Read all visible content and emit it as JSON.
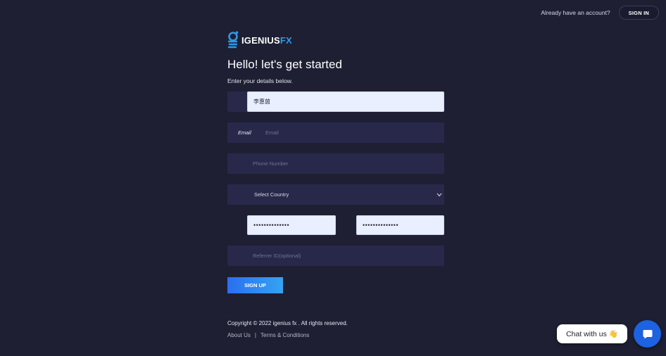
{
  "header": {
    "question": "Already have an account?",
    "signin_label": "SIGN IN"
  },
  "brand": {
    "name_main": "IGENIUS",
    "name_accent": "FX",
    "accent_color": "#2b9ae8"
  },
  "form": {
    "title": "Hello! let's get started",
    "subtitle": "Enter your details below.",
    "name_value": "李惠茵",
    "email_label": "Email",
    "email_placeholder": "Email",
    "phone_placeholder": "Phone Number",
    "country_label": "Select Country",
    "password_value": "••••••••••••••",
    "confirm_password_value": "••••••••••••••",
    "referrer_placeholder": "Referrer ID(optional)",
    "signup_label": "SIGN UP"
  },
  "footer": {
    "copyright": "Copyright © 2022 igenius fx . All rights reserved.",
    "about_label": "About Us",
    "separator": "|",
    "terms_label": "Terms & Conditions"
  },
  "chat": {
    "pill_label": "Chat with us",
    "wave_emoji": "👋"
  },
  "icons": [
    "igenius-logo-icon",
    "chevron-down-icon",
    "chat-bubble-icon"
  ]
}
